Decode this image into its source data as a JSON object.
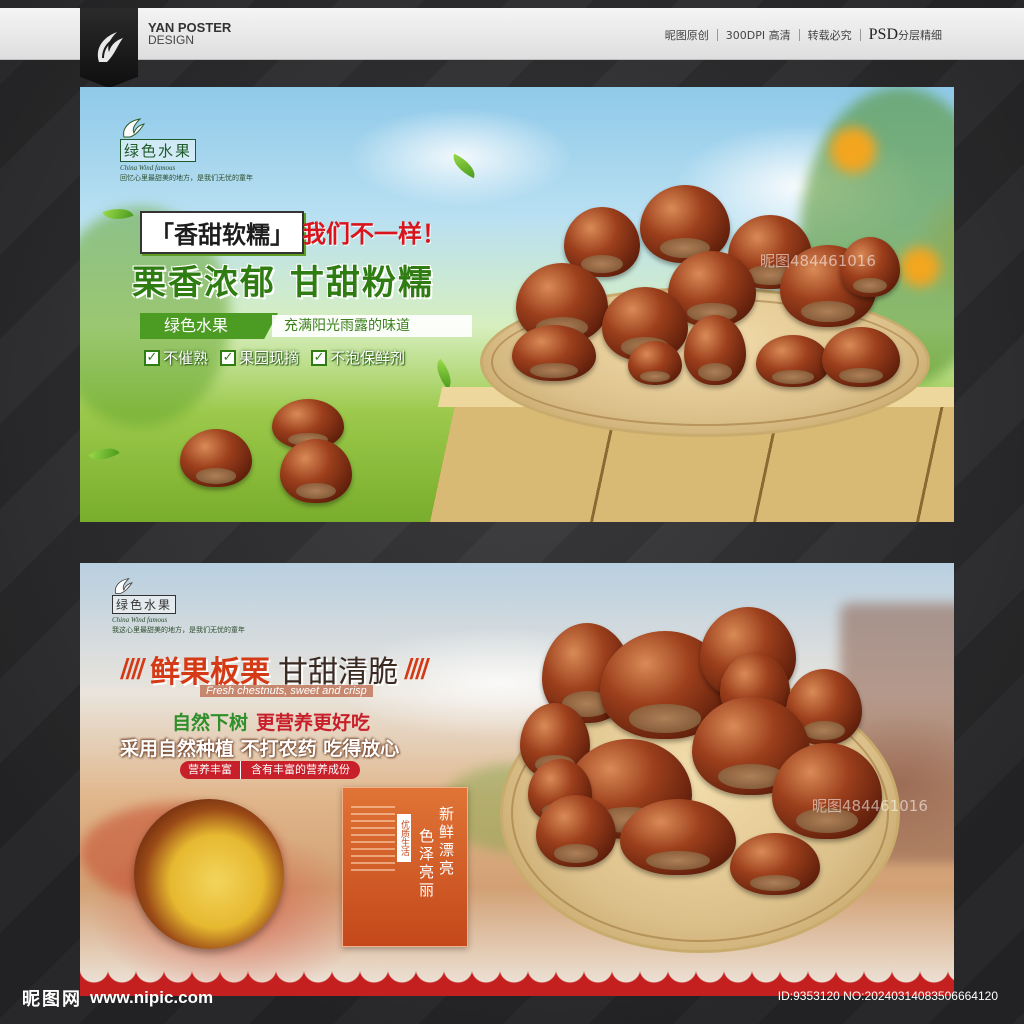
{
  "header": {
    "brand_line1": "YAN POSTER",
    "brand_line2": "DESIGN",
    "links": [
      "昵图原创",
      "300DPI 高清",
      "转载必究"
    ],
    "psd_big": "PSD",
    "psd_small": "分层精细"
  },
  "banner1": {
    "logo_name": "绿色水果",
    "logo_sub": "China Wind famous",
    "logo_slogan": "回忆心里最甜美的地方，是我们无忧的童年",
    "tag": "「香甜软糯」",
    "slogan": "我们不一样！",
    "headline": "栗香浓郁 甘甜粉糯",
    "bar_green": "绿色水果",
    "bar_white": "充满阳光雨露的味道",
    "checks": [
      "不催熟",
      "果园现摘",
      "不泡保鲜剂"
    ],
    "watermark": "昵图484461016"
  },
  "banner2": {
    "logo_name": "绿色水果",
    "logo_sub": "China Wind famous",
    "logo_slogan": "我这心里最甜美的地方，是我们无忧的童年",
    "title_red": "鲜果板栗",
    "title_dark": "甘甜清脆",
    "title_en": "Fresh chestnuts, sweet and crisp",
    "line1_green": "自然下树",
    "line1_red": "更营养更好吃",
    "line2": "采用自然种植 不打农药 吃得放心",
    "pill1": "营养丰富",
    "pill2": "含有丰富的营养成份",
    "card_stamp": "优质生活",
    "card_col1": "新鲜漂亮",
    "card_col2": "色泽亮丽",
    "watermark": "昵图484461016"
  },
  "footer": {
    "site_cn": "昵图网",
    "site_url": "www.nipic.com",
    "id_text": "ID:9353120 NO:20240314083506664120"
  },
  "colors": {
    "green": "#2f7c12",
    "red": "#d9141c",
    "orange": "#d53a16",
    "scallop": "#c3201f"
  }
}
